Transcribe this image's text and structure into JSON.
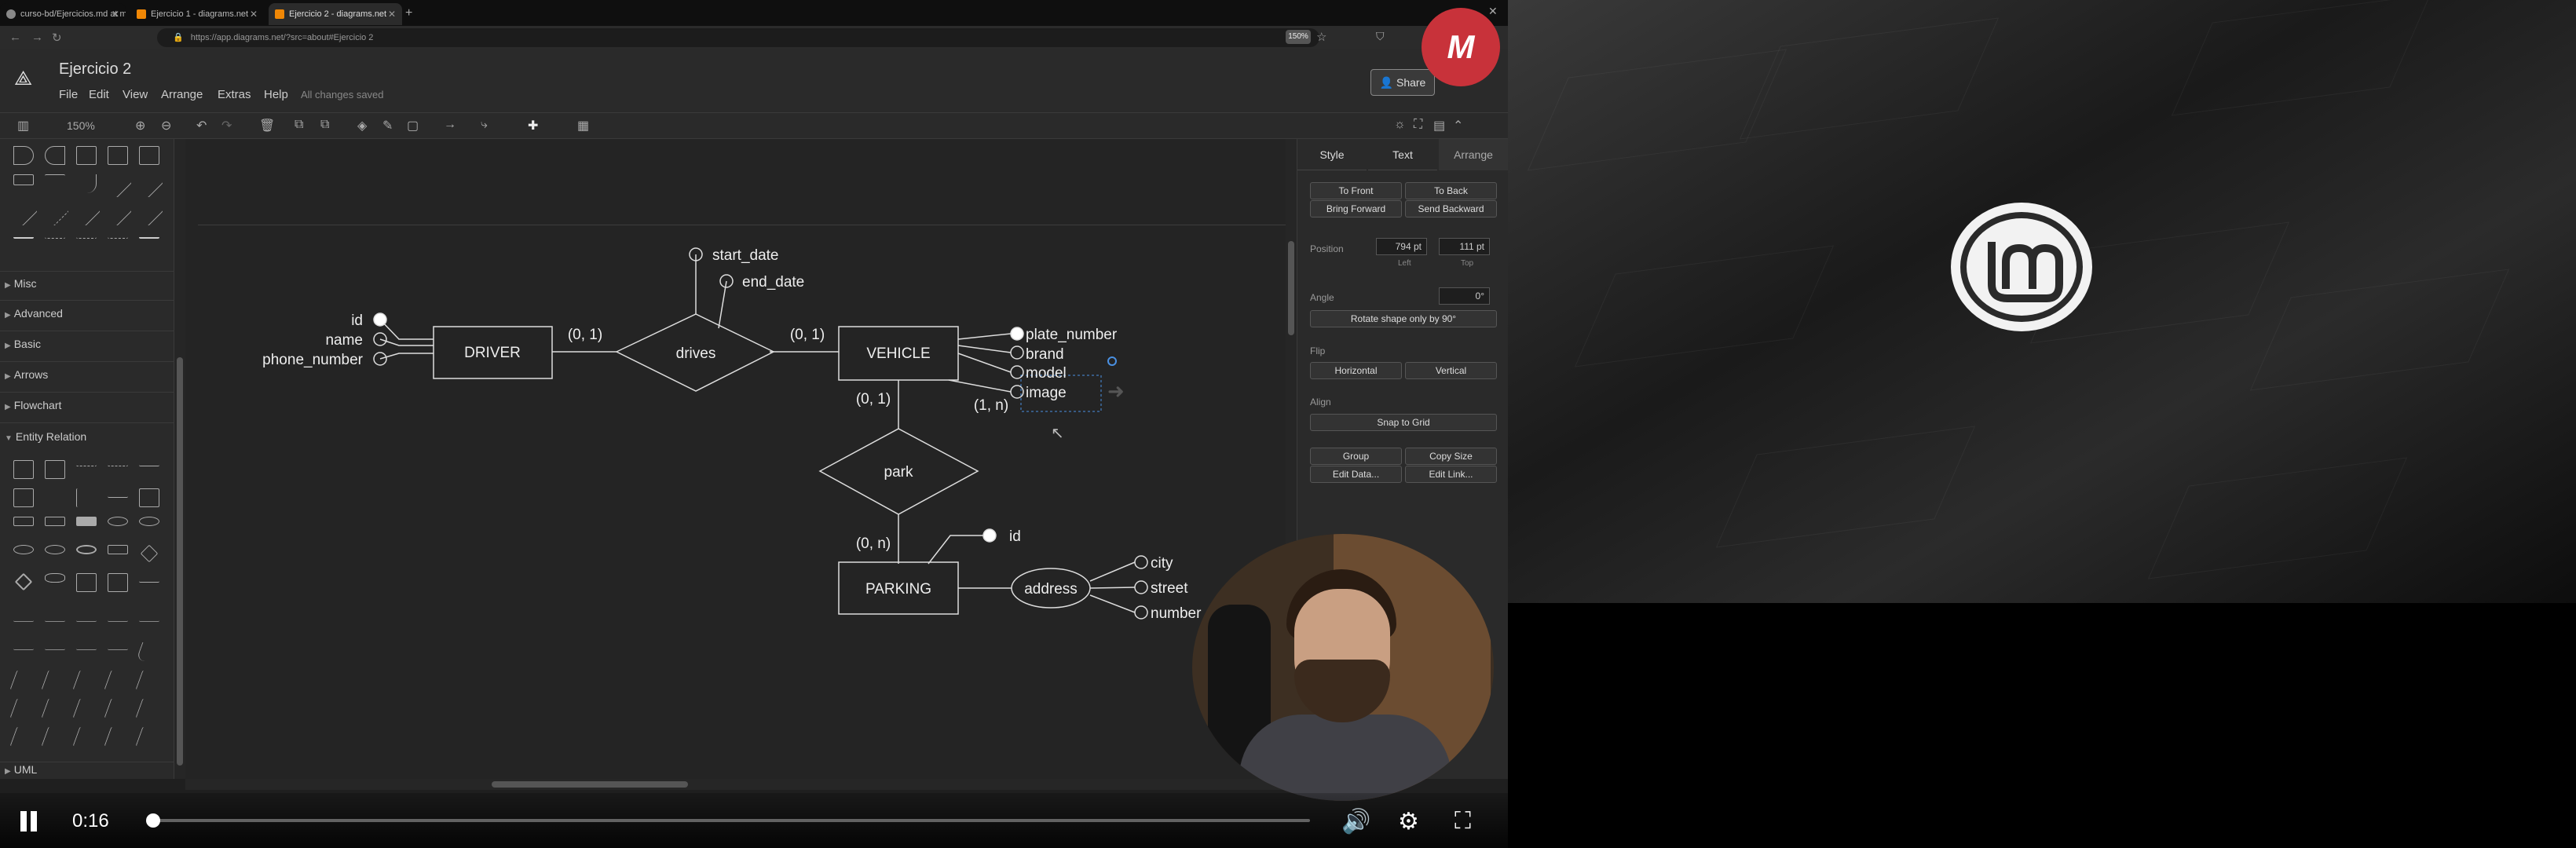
{
  "browser": {
    "tabs": [
      {
        "label": "curso-bd/Ejercicios.md at ma",
        "color": "#888888"
      },
      {
        "label": "Ejercicio 1 - diagrams.net",
        "color": "#f08705"
      },
      {
        "label": "Ejercicio 2 - diagrams.net",
        "color": "#f08705"
      }
    ],
    "url": "https://app.diagrams.net/?src=about#Ejercicio 2",
    "zoom": "150%"
  },
  "app": {
    "title": "Ejercicio 2",
    "menus": [
      "File",
      "Edit",
      "View",
      "Arrange",
      "Extras",
      "Help"
    ],
    "saved_status": "All changes saved",
    "share_label": "Share",
    "zoom_level": "150%"
  },
  "left_panel": {
    "categories": [
      "Misc",
      "Advanced",
      "Basic",
      "Arrows",
      "Flowchart",
      "Entity Relation",
      "UML"
    ]
  },
  "diagram": {
    "entities": [
      "DRIVER",
      "VEHICLE",
      "PARKING"
    ],
    "relations": [
      "drives",
      "park"
    ],
    "driver_attrs": [
      "id",
      "name",
      "phone_number"
    ],
    "drives_attrs": [
      "start_date",
      "end_date"
    ],
    "vehicle_attrs": [
      "plate_number",
      "brand",
      "model",
      "image"
    ],
    "parking_id": "id",
    "composite_attr": "address",
    "address_attrs": [
      "city",
      "street",
      "number"
    ],
    "cardinalities": {
      "driver_drives": "(0, 1)",
      "drives_vehicle": "(0, 1)",
      "vehicle_park": "(0, 1)",
      "park_parking": "(0, n)",
      "image": "(1, n)"
    }
  },
  "format_panel": {
    "tabs": [
      "Style",
      "Text",
      "Arrange"
    ],
    "to_front": "To Front",
    "to_back": "To Back",
    "bring_forward": "Bring Forward",
    "send_backward": "Send Backward",
    "position_label": "Position",
    "left_value": "794 pt",
    "top_value": "111 pt",
    "left_label": "Left",
    "top_label": "Top",
    "angle_label": "Angle",
    "angle_value": "0°",
    "rotate_label": "Rotate shape only by 90°",
    "flip_label": "Flip",
    "horizontal": "Horizontal",
    "vertical": "Vertical",
    "align_label": "Align",
    "snap": "Snap to Grid",
    "group": "Group",
    "copy_size": "Copy Size",
    "edit_data": "Edit Data...",
    "edit_link": "Edit Link..."
  },
  "player": {
    "time": "0:16",
    "progress": 0.005
  }
}
